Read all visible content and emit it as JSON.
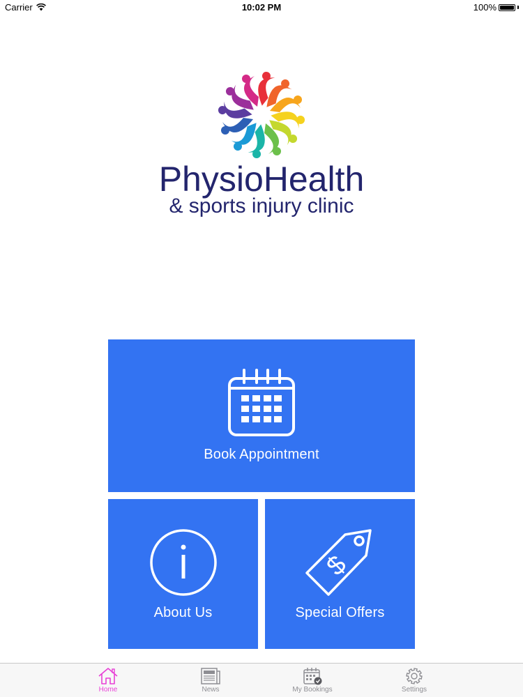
{
  "status_bar": {
    "carrier": "Carrier",
    "time": "10:02 PM",
    "battery": "100%",
    "battery_level": 1.0
  },
  "logo": {
    "title": "PhysioHealth",
    "subtitle": "& sports injury clinic",
    "color": "#23256d"
  },
  "tiles": {
    "book": {
      "label": "Book Appointment",
      "icon": "calendar-icon"
    },
    "about": {
      "label": "About Us",
      "icon": "info-icon"
    },
    "offers": {
      "label": "Special Offers",
      "icon": "price-tag-icon"
    },
    "color": "#3373f2"
  },
  "tab_bar": {
    "active_color": "#e83fd6",
    "inactive_color": "#8e8e93",
    "tabs": [
      {
        "label": "Home",
        "icon": "home-icon",
        "active": true
      },
      {
        "label": "News",
        "icon": "newspaper-icon",
        "active": false
      },
      {
        "label": "My Bookings",
        "icon": "calendar-check-icon",
        "active": false
      },
      {
        "label": "Settings",
        "icon": "gear-icon",
        "active": false
      }
    ]
  }
}
